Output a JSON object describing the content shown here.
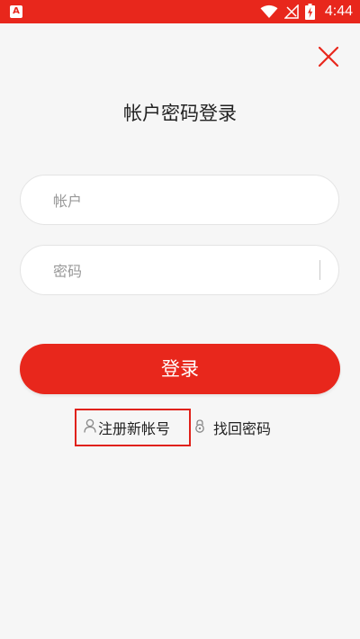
{
  "status_bar": {
    "app_icon_letter": "A",
    "time": "4:44",
    "icons": [
      "wifi-icon",
      "no-signal-icon",
      "battery-charging-icon"
    ]
  },
  "close_icon": "close-icon",
  "title": "帐户密码登录",
  "account_field": {
    "placeholder": "帐户",
    "value": ""
  },
  "password_field": {
    "placeholder": "密码",
    "value": ""
  },
  "login_button": "登录",
  "register_link": {
    "label": "注册新帐号",
    "icon": "user-icon"
  },
  "forgot_link": {
    "label": "找回密码",
    "icon": "key-lock-icon"
  },
  "colors": {
    "accent": "#e8271c",
    "background": "#f6f6f6",
    "highlight_border": "#e0211a"
  }
}
